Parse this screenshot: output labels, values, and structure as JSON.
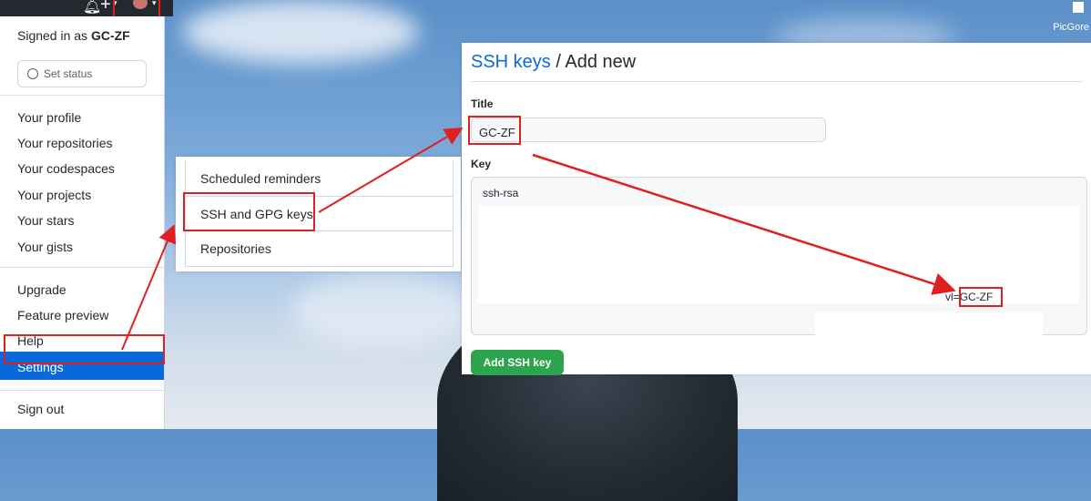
{
  "header": {
    "bell_icon": "bell-icon",
    "plus_icon": "plus-icon",
    "desktop_label": "PicGore"
  },
  "menu": {
    "signed_in_prefix": "Signed in as ",
    "username": "GC-ZF",
    "set_status": "Set status",
    "items": [
      {
        "label": "Your profile"
      },
      {
        "label": "Your repositories"
      },
      {
        "label": "Your codespaces"
      },
      {
        "label": "Your projects"
      },
      {
        "label": "Your stars"
      },
      {
        "label": "Your gists"
      }
    ],
    "upgrade": "Upgrade",
    "feature_preview": "Feature preview",
    "help": "Help",
    "settings": "Settings",
    "sign_out": "Sign out"
  },
  "sidebar": {
    "items": [
      {
        "label": "Scheduled reminders"
      },
      {
        "label": "SSH and GPG keys"
      },
      {
        "label": "Repositories"
      }
    ]
  },
  "form": {
    "breadcrumb_link": "SSH keys",
    "breadcrumb_sep": " / ",
    "breadcrumb_current": "Add new",
    "title_label": "Title",
    "title_value": "GC-ZF",
    "key_label": "Key",
    "key_prefix": "ssh-rsa",
    "key_suffix": "vl=",
    "key_suffix_name": "GC-ZF",
    "submit_label": "Add SSH key"
  },
  "colors": {
    "annotation": "#e02020",
    "accent": "#0969da",
    "submit": "#2da44e"
  }
}
